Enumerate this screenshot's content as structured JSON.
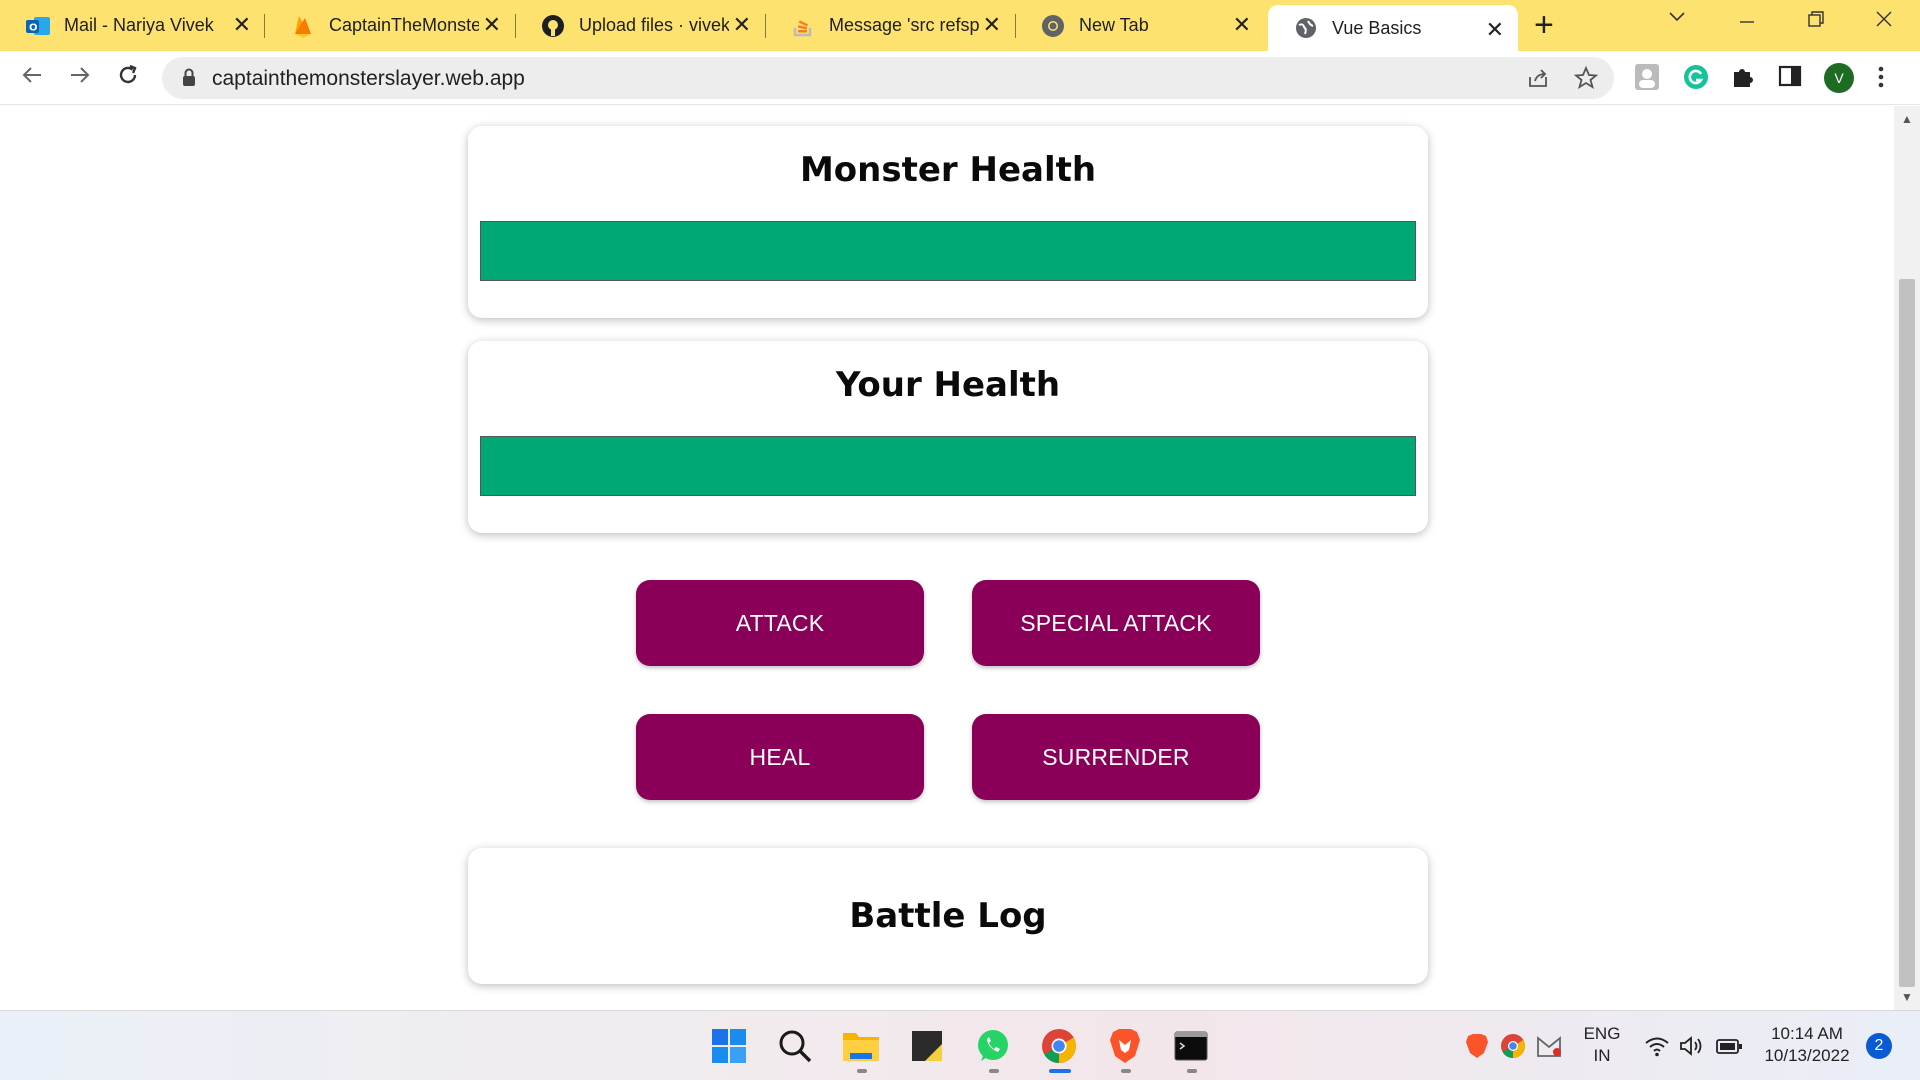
{
  "browser": {
    "tabs": [
      {
        "title": "Mail - Nariya Vivek",
        "icon": "outlook-icon"
      },
      {
        "title": "CaptainTheMonsterSlayer",
        "icon": "firebase-icon"
      },
      {
        "title": "Upload files · vivekn",
        "icon": "github-icon"
      },
      {
        "title": "Message 'src refspec",
        "icon": "stackoverflow-icon"
      },
      {
        "title": "New Tab",
        "icon": "chrome-icon"
      },
      {
        "title": "Vue Basics",
        "icon": "globe-icon",
        "active": true
      }
    ],
    "url": "captainthemonsterslayer.web.app",
    "profile_initial": "V"
  },
  "game": {
    "monster_title": "Monster Health",
    "monster_health_percent": 100,
    "player_title": "Your Health",
    "player_health_percent": 100,
    "buttons": {
      "attack": "ATTACK",
      "special_attack": "SPECIAL ATTACK",
      "heal": "HEAL",
      "surrender": "SURRENDER"
    },
    "log_title": "Battle Log"
  },
  "colors": {
    "health_fill": "#00a876",
    "button_bg": "#8a0058",
    "tab_strip": "#fde270"
  },
  "taskbar": {
    "lang_line1": "ENG",
    "lang_line2": "IN",
    "time": "10:14 AM",
    "date": "10/13/2022",
    "notification_count": "2"
  }
}
